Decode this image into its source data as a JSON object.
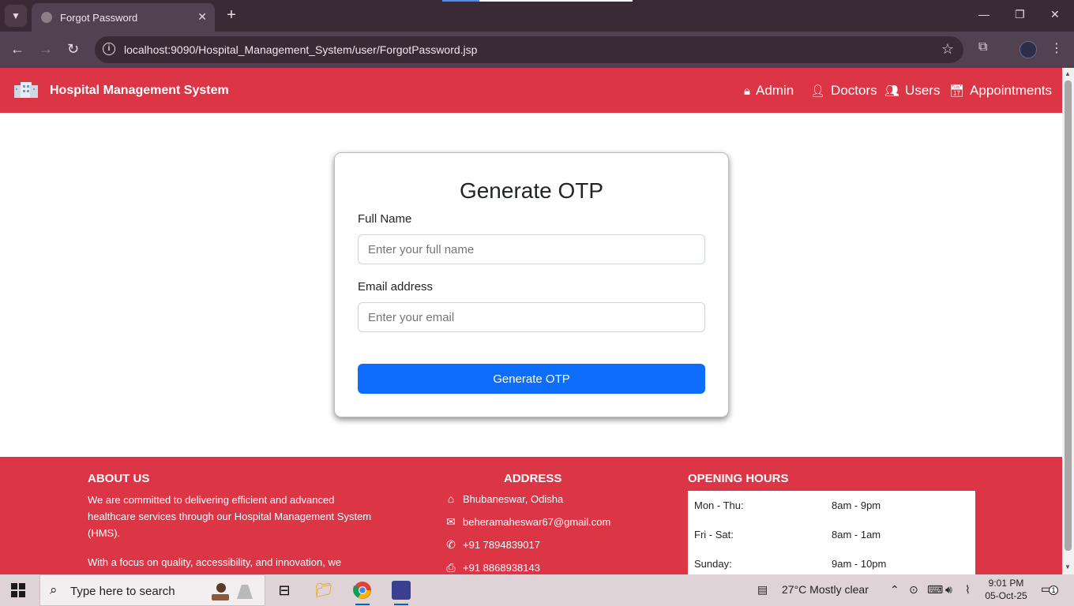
{
  "browser": {
    "tab_title": "Forgot Password",
    "url": "localhost:9090/Hospital_Management_System/user/ForgotPassword.jsp"
  },
  "navbar": {
    "brand": "Hospital Management System",
    "items": [
      {
        "label": "Admin",
        "icon": "lock-icon"
      },
      {
        "label": "Doctors",
        "icon": "doctor-icon"
      },
      {
        "label": "Users",
        "icon": "users-icon"
      },
      {
        "label": "Appointments",
        "icon": "calendar-check-icon"
      }
    ]
  },
  "form": {
    "title": "Generate OTP",
    "full_name_label": "Full Name",
    "full_name_placeholder": "Enter your full name",
    "email_label": "Email address",
    "email_placeholder": "Enter your email",
    "submit_label": "Generate OTP"
  },
  "footer": {
    "about": {
      "heading": "ABOUT US",
      "paragraph1": "We are committed to delivering efficient and advanced healthcare services through our Hospital Management System (HMS).",
      "paragraph2": "With a focus on quality, accessibility, and innovation, we"
    },
    "address": {
      "heading": "ADDRESS",
      "location": "Bhubaneswar, Odisha",
      "email": "beheramaheswar67@gmail.com",
      "phone": "+91 7894839017",
      "fax": "+91 8868938143"
    },
    "hours": {
      "heading": "OPENING HOURS",
      "rows": [
        {
          "day": "Mon - Thu:",
          "time": "8am - 9pm"
        },
        {
          "day": "Fri - Sat:",
          "time": "8am - 1am"
        },
        {
          "day": "Sunday:",
          "time": "9am - 10pm"
        }
      ]
    }
  },
  "taskbar": {
    "search_placeholder": "Type here to search",
    "weather": "27°C  Mostly clear",
    "time": "9:01 PM",
    "date": "05-Oct-25",
    "notification_count": "1"
  },
  "colors": {
    "brand_red": "#dc3545",
    "primary_blue": "#0d6efd"
  }
}
